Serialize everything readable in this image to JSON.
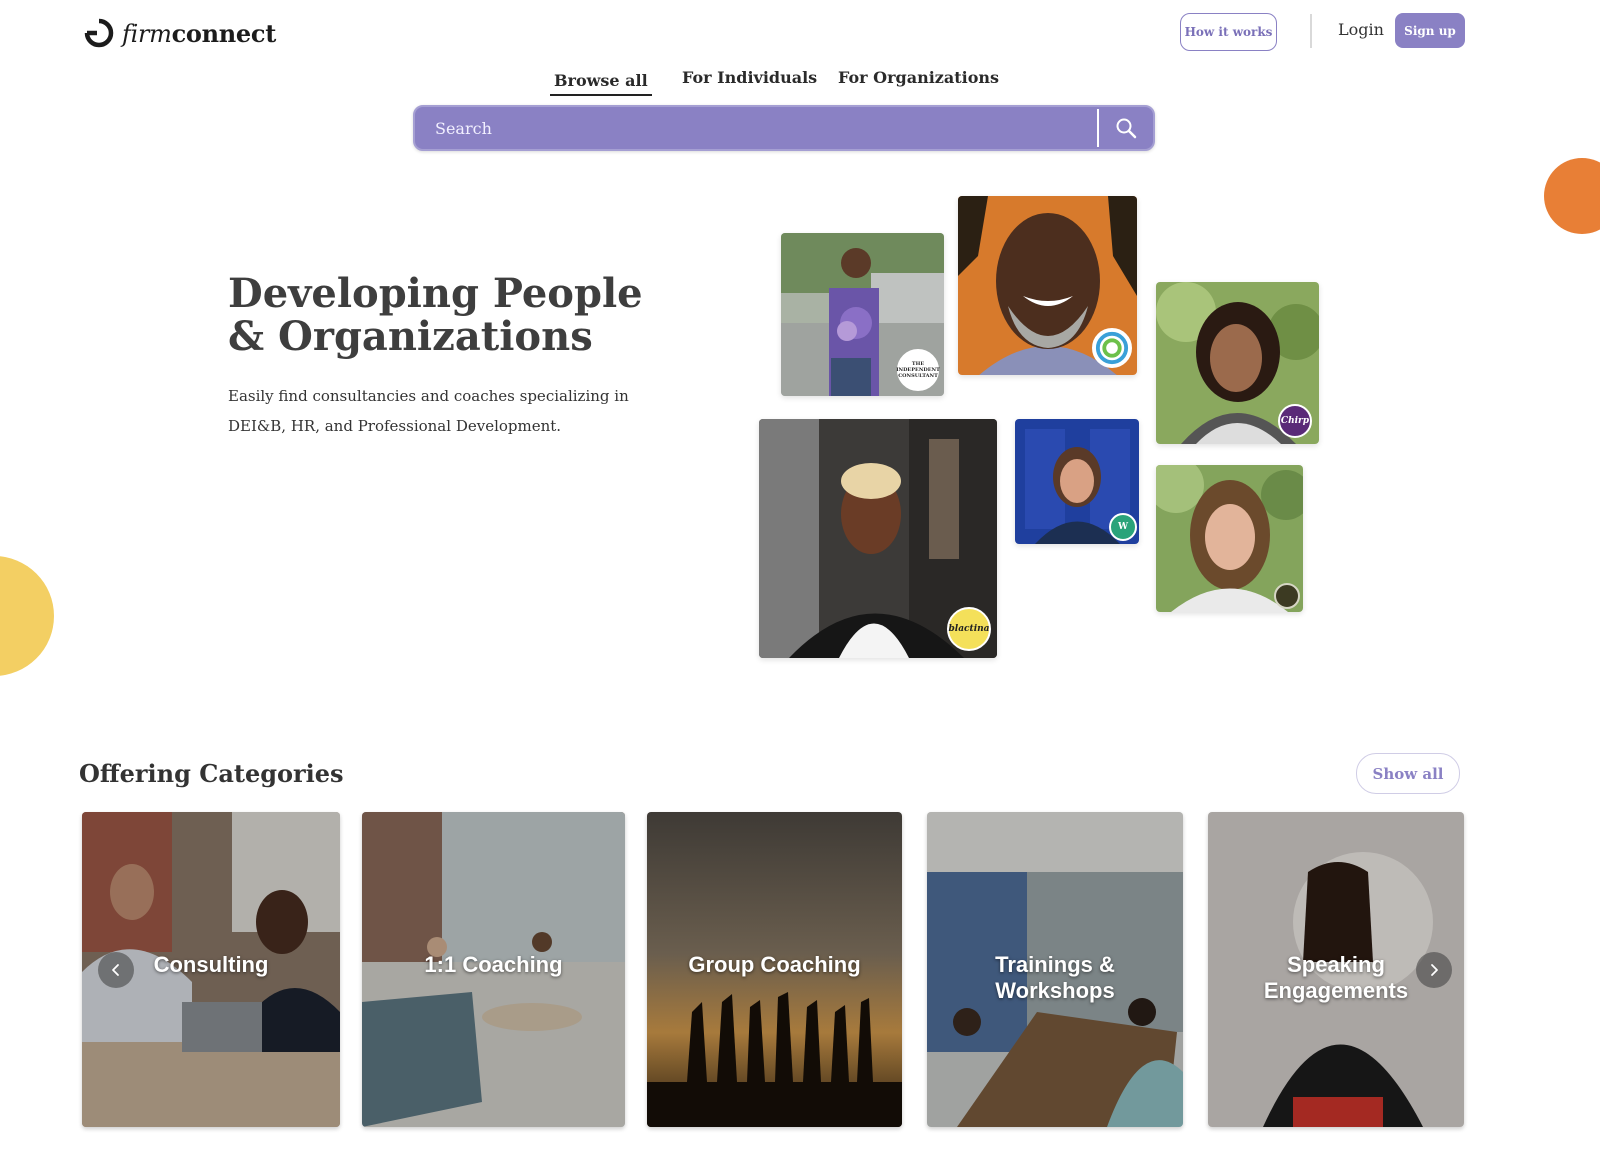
{
  "header": {
    "logo_italic": "firm",
    "logo_bold": "connect",
    "how_it_works_label": "How it works",
    "login_label": "Login",
    "signup_label": "Sign up"
  },
  "nav": {
    "tabs": [
      {
        "label": "Browse all",
        "active": true
      },
      {
        "label": "For Individuals",
        "active": false
      },
      {
        "label": "For Organizations",
        "active": false
      }
    ]
  },
  "search": {
    "placeholder": "Search",
    "value": "",
    "icon": "search-icon"
  },
  "hero": {
    "title": "Developing People & Organizations",
    "subtitle": "Easily find consultancies and coaches specializing in DEI&B, HR, and Professional Development.",
    "photos": [
      {
        "name": "profile-photo-woman-flowers",
        "badge_text": "THE INDEPENDENT CONSULTANT"
      },
      {
        "name": "profile-photo-man-smiling",
        "badge_text": ""
      },
      {
        "name": "profile-photo-woman-curly-hair",
        "badge_text": "Chirp"
      },
      {
        "name": "profile-photo-woman-blonde-short-hair",
        "badge_text": "blactina"
      },
      {
        "name": "profile-photo-woman-blue-door",
        "badge_text": "W"
      },
      {
        "name": "profile-photo-woman-brown-hair",
        "badge_text": ""
      }
    ]
  },
  "categories": {
    "title": "Offering Categories",
    "show_all_label": "Show all",
    "items": [
      {
        "label": "Consulting"
      },
      {
        "label": "1:1 Coaching"
      },
      {
        "label": "Group Coaching"
      },
      {
        "label": "Trainings & Workshops"
      },
      {
        "label": "Speaking Engagements"
      }
    ]
  },
  "colors": {
    "brand_purple": "#8a81c4",
    "accent_orange": "#e87f36",
    "accent_yellow": "#f3cf63"
  }
}
